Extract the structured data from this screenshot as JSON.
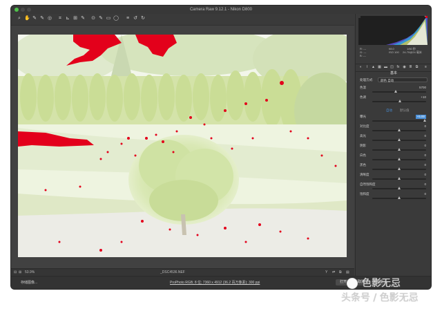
{
  "window": {
    "title": "Camera Raw 9.12.1 - Nikon D800"
  },
  "toolbar": {
    "tools": [
      {
        "name": "zoom-tool-icon",
        "glyph": "⌕"
      },
      {
        "name": "hand-tool-icon",
        "glyph": "✋"
      },
      {
        "name": "white-balance-tool-icon",
        "glyph": "✎"
      },
      {
        "name": "color-sampler-tool-icon",
        "glyph": "✎"
      },
      {
        "name": "targeted-adjust-tool-icon",
        "glyph": "◎"
      },
      {
        "name": "crop-tool-icon",
        "glyph": "⌗"
      },
      {
        "name": "straighten-tool-icon",
        "glyph": "⊾"
      },
      {
        "name": "transform-tool-icon",
        "glyph": "⊞"
      },
      {
        "name": "spot-removal-tool-icon",
        "glyph": "✎"
      },
      {
        "name": "red-eye-tool-icon",
        "glyph": "⊙"
      },
      {
        "name": "adjustment-brush-icon",
        "glyph": "✎"
      },
      {
        "name": "graduated-filter-icon",
        "glyph": "▭"
      },
      {
        "name": "radial-filter-icon",
        "glyph": "◯"
      },
      {
        "name": "preferences-icon",
        "glyph": "≡"
      },
      {
        "name": "rotate-left-icon",
        "glyph": "↺"
      },
      {
        "name": "rotate-right-icon",
        "glyph": "↻"
      }
    ]
  },
  "status": {
    "zoom": "53.9%",
    "filename": "_DSC4536.NEF"
  },
  "bottombar": {
    "save_label": "存储图像...",
    "info_link": "ProPhoto RGB; 8 位; 7360 x 4912 (36.2 百万像素); 300 ppi",
    "open_label": "打开",
    "cancel_label": "取消",
    "done_label": "完成"
  },
  "panel": {
    "readout": {
      "r": "R: ---",
      "g": "G: ---",
      "b": "B: ---",
      "f": "f/8.0",
      "shutter": "1/60 秒",
      "iso": "ISO 100",
      "lens": "24-70@24 毫米"
    },
    "title": "基本",
    "process_label": "处理方式:",
    "process_value": "颜色 自动",
    "profile_label": "色温",
    "sliders_top": [
      {
        "label": "色温",
        "value": "5700",
        "pos": 0.44
      },
      {
        "label": "色调",
        "value": "+10",
        "pos": 0.52
      }
    ],
    "auto_label": "自动",
    "default_label": "默认值",
    "sliders": [
      {
        "label": "曝光",
        "value": "+5.00",
        "pos": 0.98,
        "highlight": true
      },
      {
        "label": "对比度",
        "value": "0",
        "pos": 0.5
      },
      {
        "label": "高光",
        "value": "0",
        "pos": 0.5
      },
      {
        "label": "阴影",
        "value": "0",
        "pos": 0.5
      },
      {
        "label": "白色",
        "value": "0",
        "pos": 0.5
      },
      {
        "label": "黑色",
        "value": "0",
        "pos": 0.5
      },
      {
        "label": "清晰度",
        "value": "0",
        "pos": 0.5
      },
      {
        "label": "自然饱和度",
        "value": "0",
        "pos": 0.5
      },
      {
        "label": "饱和度",
        "value": "0",
        "pos": 0.5
      }
    ]
  },
  "watermark": {
    "line1": "色影无忌",
    "line2": "头条号 / 色影无忌"
  },
  "colors": {
    "clip": "#e3001b",
    "accent": "#4a90d9"
  }
}
